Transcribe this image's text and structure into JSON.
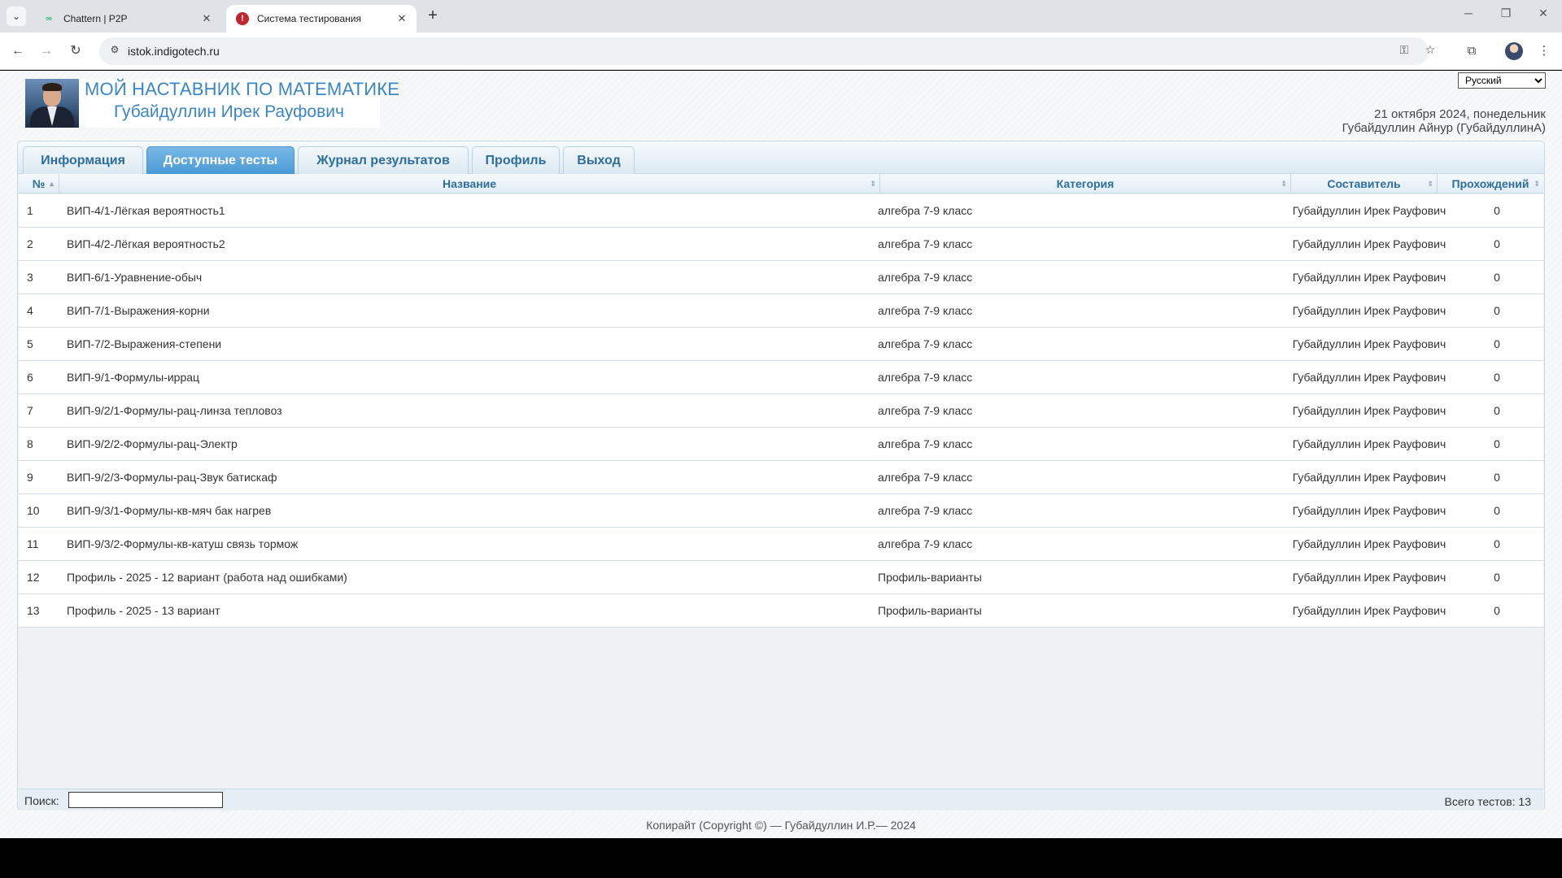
{
  "browser": {
    "tabs": [
      {
        "title": "Chattern | P2P",
        "active": false
      },
      {
        "title": "Система тестирования",
        "active": true
      }
    ],
    "url": "istok.indigotech.ru"
  },
  "header": {
    "language": "Русский",
    "title": "МОЙ НАСТАВНИК ПО МАТЕМАТИКЕ",
    "subtitle": "Губайдуллин Ирек Рауфович",
    "date": "21 октября 2024, понедельник",
    "user": "Губайдуллин Айнур (ГубайдуллинА)"
  },
  "nav_tabs": [
    {
      "label": "Информация",
      "active": false
    },
    {
      "label": "Доступные тесты",
      "active": true
    },
    {
      "label": "Журнал результатов",
      "active": false
    },
    {
      "label": "Профиль",
      "active": false
    },
    {
      "label": "Выход",
      "active": false
    }
  ],
  "table": {
    "columns": [
      "№",
      "Название",
      "Категория",
      "Составитель",
      "Прохождений"
    ],
    "rows": [
      {
        "num": "1",
        "name": "ВИП-4/1-Лёгкая вероятность1",
        "category": "алгебра 7-9 класс",
        "author": "Губайдуллин Ирек Рауфович",
        "count": "0"
      },
      {
        "num": "2",
        "name": "ВИП-4/2-Лёгкая вероятность2",
        "category": "алгебра 7-9 класс",
        "author": "Губайдуллин Ирек Рауфович",
        "count": "0"
      },
      {
        "num": "3",
        "name": "ВИП-6/1-Уравнение-обыч",
        "category": "алгебра 7-9 класс",
        "author": "Губайдуллин Ирек Рауфович",
        "count": "0"
      },
      {
        "num": "4",
        "name": "ВИП-7/1-Выражения-корни",
        "category": "алгебра 7-9 класс",
        "author": "Губайдуллин Ирек Рауфович",
        "count": "0"
      },
      {
        "num": "5",
        "name": "ВИП-7/2-Выражения-степени",
        "category": "алгебра 7-9 класс",
        "author": "Губайдуллин Ирек Рауфович",
        "count": "0"
      },
      {
        "num": "6",
        "name": "ВИП-9/1-Формулы-иррац",
        "category": "алгебра 7-9 класс",
        "author": "Губайдуллин Ирек Рауфович",
        "count": "0"
      },
      {
        "num": "7",
        "name": "ВИП-9/2/1-Формулы-рац-линза тепловоз",
        "category": "алгебра 7-9 класс",
        "author": "Губайдуллин Ирек Рауфович",
        "count": "0"
      },
      {
        "num": "8",
        "name": "ВИП-9/2/2-Формулы-рац-Электр",
        "category": "алгебра 7-9 класс",
        "author": "Губайдуллин Ирек Рауфович",
        "count": "0"
      },
      {
        "num": "9",
        "name": "ВИП-9/2/3-Формулы-рац-Звук батискаф",
        "category": "алгебра 7-9 класс",
        "author": "Губайдуллин Ирек Рауфович",
        "count": "0"
      },
      {
        "num": "10",
        "name": "ВИП-9/3/1-Формулы-кв-мяч бак нагрев",
        "category": "алгебра 7-9 класс",
        "author": "Губайдуллин Ирек Рауфович",
        "count": "0"
      },
      {
        "num": "11",
        "name": "ВИП-9/3/2-Формулы-кв-катуш связь тормож",
        "category": "алгебра 7-9 класс",
        "author": "Губайдуллин Ирек Рауфович",
        "count": "0"
      },
      {
        "num": "12",
        "name": "Профиль - 2025 - 12 вариант (работа над ошибками)",
        "category": "Профиль-варианты",
        "author": "Губайдуллин Ирек Рауфович",
        "count": "0"
      },
      {
        "num": "13",
        "name": "Профиль - 2025 - 13 вариант",
        "category": "Профиль-варианты",
        "author": "Губайдуллин Ирек Рауфович",
        "count": "0"
      }
    ]
  },
  "footer": {
    "search_label": "Поиск:",
    "search_value": "",
    "total": "Всего тестов: 13",
    "copyright": "Копирайт (Copyright ©) — Губайдуллин И.Р.— 2024"
  }
}
